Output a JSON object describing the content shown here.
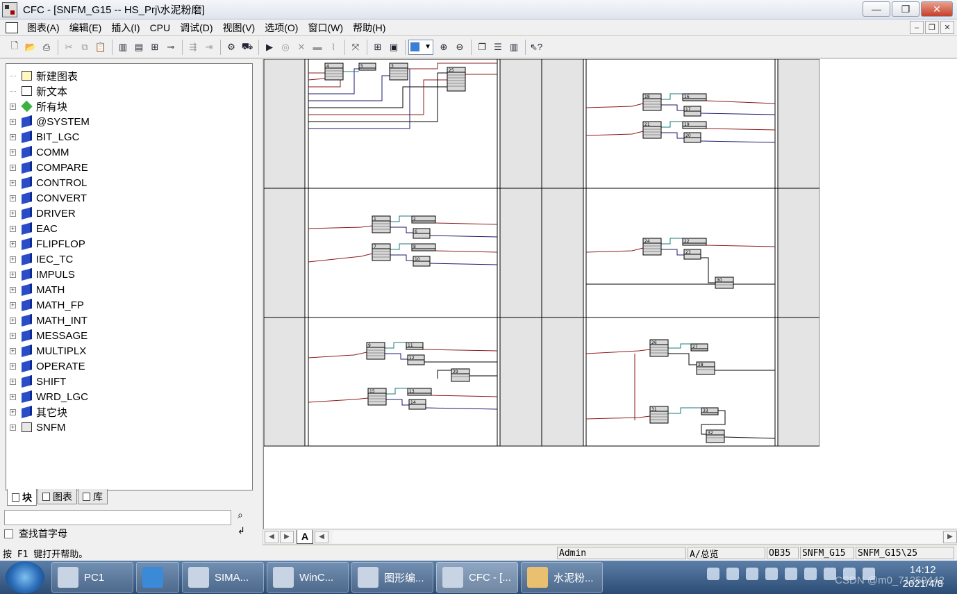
{
  "window": {
    "title": "CFC - [SNFM_G15 -- HS_Prj\\水泥粉磨]",
    "minimize": "—",
    "restore": "❐",
    "close": "✕"
  },
  "menu": {
    "items": [
      "图表(A)",
      "编辑(E)",
      "插入(I)",
      "CPU",
      "调试(D)",
      "视图(V)",
      "选项(O)",
      "窗口(W)",
      "帮助(H)"
    ],
    "mdi_min": "–",
    "mdi_restore": "❐",
    "mdi_close": "✕"
  },
  "tree": {
    "items": [
      {
        "label": "新建图表",
        "icon": "chart-icon"
      },
      {
        "label": "新文本",
        "icon": "doc-icon"
      },
      {
        "label": "所有块",
        "icon": "green-icon"
      },
      {
        "label": "@SYSTEM",
        "icon": "book-icon"
      },
      {
        "label": "BIT_LGC",
        "icon": "book-icon"
      },
      {
        "label": "COMM",
        "icon": "book-icon"
      },
      {
        "label": "COMPARE",
        "icon": "book-icon"
      },
      {
        "label": "CONTROL",
        "icon": "book-icon"
      },
      {
        "label": "CONVERT",
        "icon": "book-icon"
      },
      {
        "label": "DRIVER",
        "icon": "book-icon"
      },
      {
        "label": "EAC",
        "icon": "book-icon"
      },
      {
        "label": "FLIPFLOP",
        "icon": "book-icon"
      },
      {
        "label": "IEC_TC",
        "icon": "book-icon"
      },
      {
        "label": "IMPULS",
        "icon": "book-icon"
      },
      {
        "label": "MATH",
        "icon": "book-icon"
      },
      {
        "label": "MATH_FP",
        "icon": "book-icon"
      },
      {
        "label": "MATH_INT",
        "icon": "book-icon"
      },
      {
        "label": "MESSAGE",
        "icon": "book-icon"
      },
      {
        "label": "MULTIPLX",
        "icon": "book-icon"
      },
      {
        "label": "OPERATE",
        "icon": "book-icon"
      },
      {
        "label": "SHIFT",
        "icon": "book-icon"
      },
      {
        "label": "WRD_LGC",
        "icon": "book-icon"
      },
      {
        "label": "其它块",
        "icon": "book-icon"
      },
      {
        "label": "SNFM",
        "icon": "plc-icon"
      }
    ]
  },
  "tabs": {
    "blocks": "块",
    "charts": "图表",
    "library": "库"
  },
  "search": {
    "value": "",
    "first_letter_label": "查找首字母"
  },
  "sheet": {
    "tab": "A"
  },
  "status": {
    "help": "按 F1 键打开帮助。",
    "user": "Admin",
    "sheet": "A/总览",
    "ob": "OB35",
    "chart": "SNFM_G15",
    "path": "SNFM_G15\\25"
  },
  "blocks": {
    "top_left": [
      "4",
      "5",
      "3",
      "25"
    ],
    "top_right": [
      "18",
      "16",
      "17",
      "21",
      "19",
      "20"
    ],
    "mid_left": [
      "1",
      "2",
      "6",
      "7",
      "8",
      "10"
    ],
    "mid_right": [
      "24",
      "22",
      "23",
      "30"
    ],
    "bot_left": [
      "9",
      "11",
      "12",
      "29",
      "15",
      "13",
      "14"
    ],
    "bot_right": [
      "26",
      "27",
      "28",
      "31",
      "33",
      "32"
    ]
  },
  "taskbar": {
    "items": [
      "PC1",
      "SIMA...",
      "WinC...",
      "图形编...",
      "CFC - [...",
      "水泥粉..."
    ],
    "time": "14:12",
    "date": "2021/4/8",
    "watermark": "CSDN @m0_71259442"
  },
  "colors": {
    "wire_red": "#8b1a1a",
    "wire_teal": "#1a7a7a",
    "wire_blue": "#1a1a6b",
    "block_fill": "#d8d8d8"
  }
}
